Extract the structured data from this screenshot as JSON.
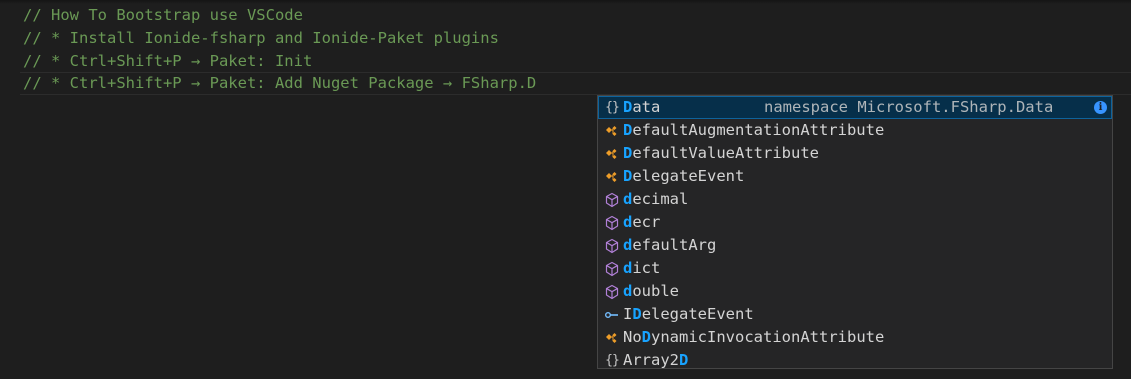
{
  "editor": {
    "lines": [
      "// How To Bootstrap use VSCode",
      "// * Install Ionide-fsharp and Ionide-Paket plugins",
      "// * Ctrl+Shift+P → Paket: Init",
      "// * Ctrl+Shift+P → Paket: Add Nuget Package → FSharp.D"
    ]
  },
  "suggest": {
    "items": [
      {
        "kind": "namespace-icon",
        "pre": "",
        "match": "D",
        "post": "ata",
        "detail": "namespace Microsoft.FSharp.Data",
        "selected": true
      },
      {
        "kind": "class-icon",
        "pre": "",
        "match": "D",
        "post": "efaultAugmentationAttribute"
      },
      {
        "kind": "class-icon",
        "pre": "",
        "match": "D",
        "post": "efaultValueAttribute"
      },
      {
        "kind": "class-icon",
        "pre": "",
        "match": "D",
        "post": "elegateEvent"
      },
      {
        "kind": "function-icon",
        "pre": "",
        "match": "d",
        "post": "ecimal"
      },
      {
        "kind": "function-icon",
        "pre": "",
        "match": "d",
        "post": "ecr"
      },
      {
        "kind": "function-icon",
        "pre": "",
        "match": "d",
        "post": "efaultArg"
      },
      {
        "kind": "function-icon",
        "pre": "",
        "match": "d",
        "post": "ict"
      },
      {
        "kind": "function-icon",
        "pre": "",
        "match": "d",
        "post": "ouble"
      },
      {
        "kind": "interface-icon",
        "pre": "I",
        "match": "D",
        "post": "elegateEvent"
      },
      {
        "kind": "class-icon",
        "pre": "No",
        "match": "D",
        "post": "ynamicInvocationAttribute"
      },
      {
        "kind": "namespace-icon",
        "pre": "Array2",
        "match": "D",
        "post": ""
      }
    ],
    "info_glyph": "i"
  },
  "colors": {
    "comment": "#6a9955",
    "highlight": "#18a3ff",
    "class_icon": "#ee9d28",
    "function_icon": "#b180d7",
    "interface_icon": "#75beff"
  }
}
